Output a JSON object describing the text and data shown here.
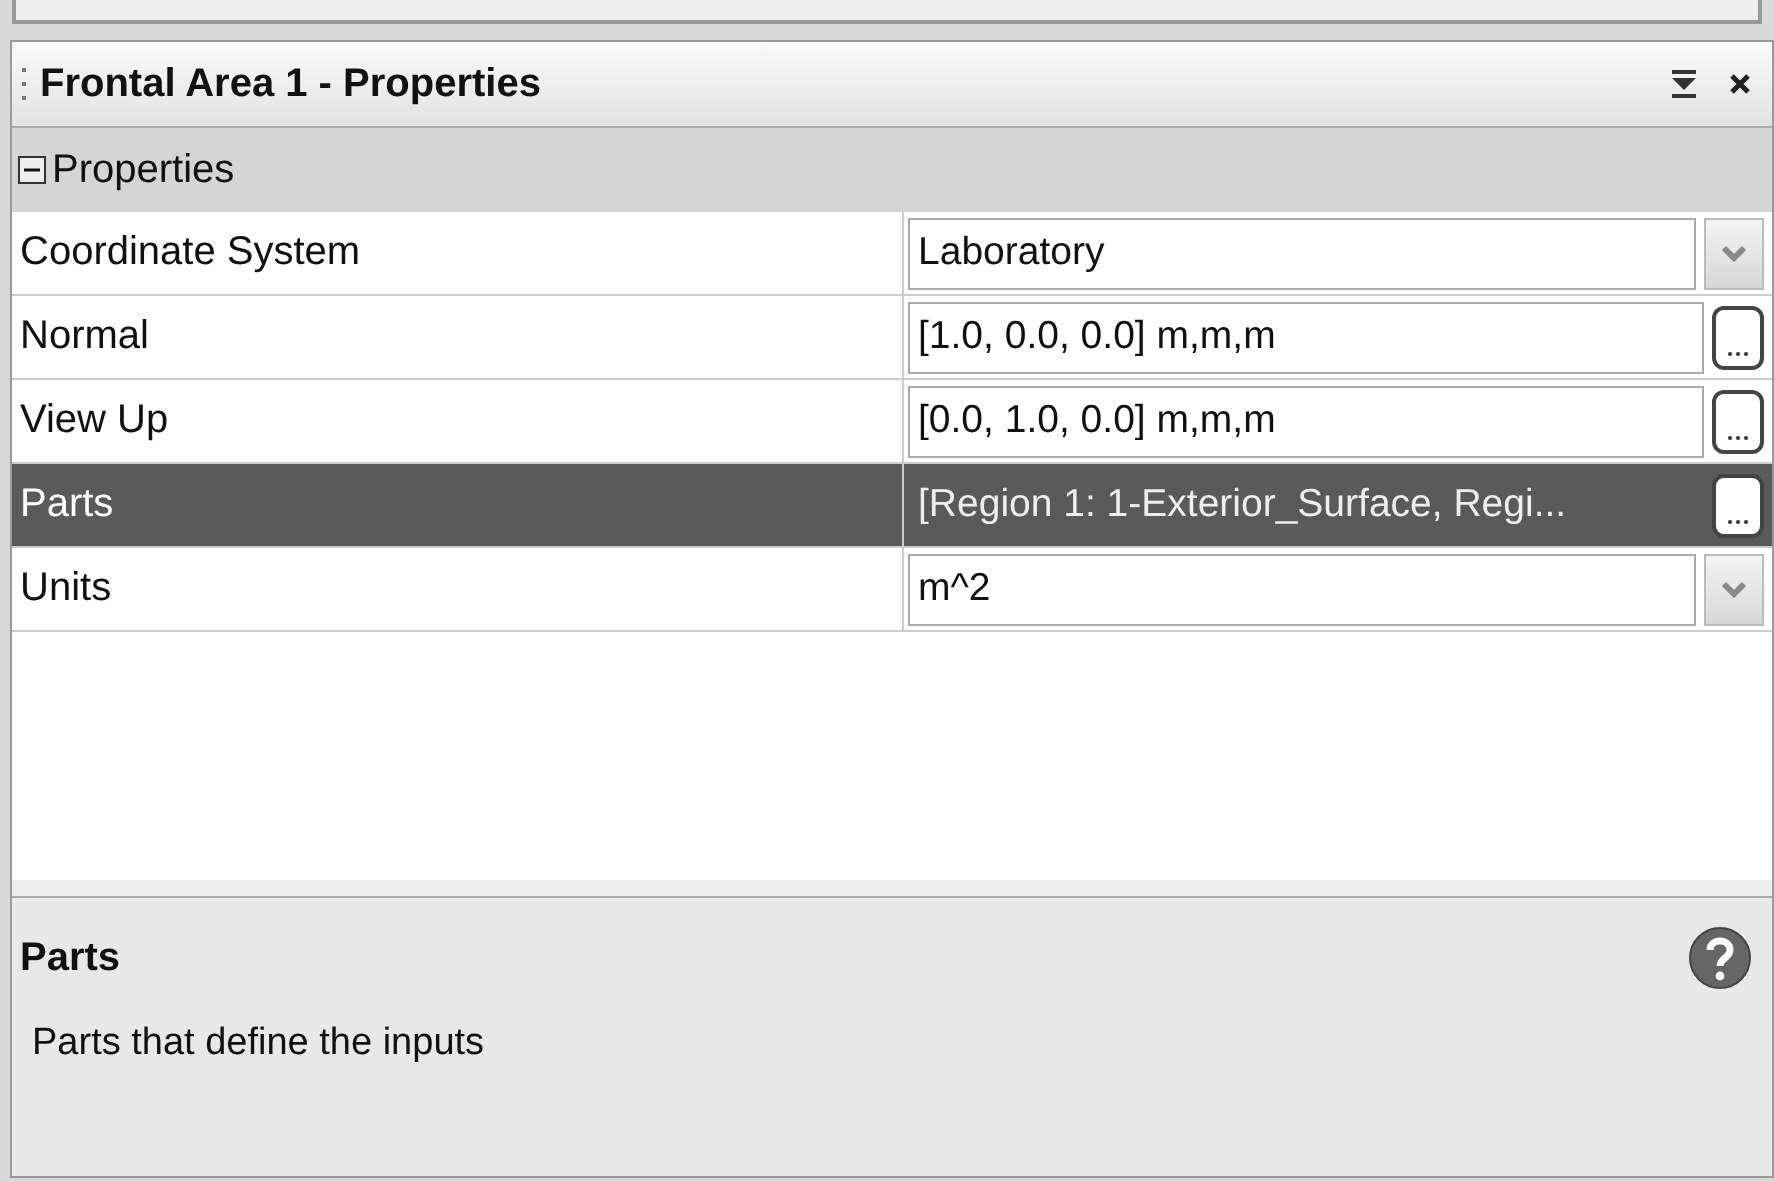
{
  "panel": {
    "title": "Frontal Area 1 - Properties"
  },
  "section": {
    "label": "Properties",
    "expanded": true
  },
  "rows": [
    {
      "name": "Coordinate System",
      "value": "Laboratory",
      "kind": "dropdown",
      "selected": false
    },
    {
      "name": "Normal",
      "value": "[1.0, 0.0, 0.0] m,m,m",
      "kind": "ellipsis",
      "selected": false
    },
    {
      "name": "View Up",
      "value": "[0.0, 1.0, 0.0] m,m,m",
      "kind": "ellipsis",
      "selected": false
    },
    {
      "name": "Parts",
      "value": "[Region 1: 1-Exterior_Surface, Regi...",
      "kind": "ellipsis",
      "selected": true
    },
    {
      "name": "Units",
      "value": "m^2",
      "kind": "dropdown",
      "selected": false
    }
  ],
  "description": {
    "title": "Parts",
    "text": "Parts that define the inputs"
  }
}
